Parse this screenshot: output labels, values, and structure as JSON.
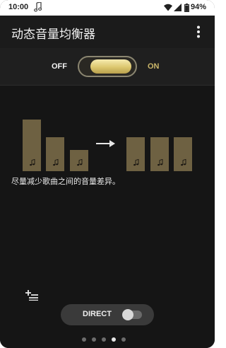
{
  "status_bar": {
    "time": "10:00",
    "battery_percent": "94%",
    "battery_level": 0.94,
    "icons": [
      "music-note-icon",
      "wifi-icon",
      "signal-icon",
      "battery-icon"
    ]
  },
  "app_bar": {
    "title": "动态音量均衡器",
    "menu_icon": "more-vert-icon"
  },
  "main_switch": {
    "off_label": "OFF",
    "on_label": "ON",
    "state": "on"
  },
  "illustration": {
    "arrow_icon": "arrow-right-icon",
    "note_icon": "music-note-icon",
    "bars_before": [
      1.0,
      0.67,
      0.42
    ],
    "bars_after": [
      0.67,
      0.67,
      0.67
    ]
  },
  "description": "尽量减少歌曲之间的音量差异。",
  "bottom": {
    "add_queue_icon": "playlist-add-icon",
    "direct_label": "DIRECT",
    "direct_state": "off"
  },
  "pager": {
    "count": 5,
    "active_index": 3
  },
  "colors": {
    "accent_gold": "#cbb66a",
    "bar_fill": "#6e6142",
    "background": "#151515"
  }
}
